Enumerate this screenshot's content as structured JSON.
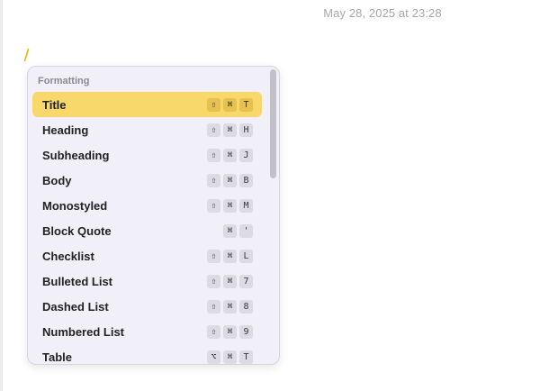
{
  "note": {
    "timestamp": "May 28, 2025 at 23:28",
    "cursor_char": "/"
  },
  "popup": {
    "section_title": "Formatting",
    "scroll_position": 0,
    "items": [
      {
        "label": "Title",
        "keys": [
          "⇧",
          "⌘",
          "T"
        ],
        "selected": true
      },
      {
        "label": "Heading",
        "keys": [
          "⇧",
          "⌘",
          "H"
        ],
        "selected": false
      },
      {
        "label": "Subheading",
        "keys": [
          "⇧",
          "⌘",
          "J"
        ],
        "selected": false
      },
      {
        "label": "Body",
        "keys": [
          "⇧",
          "⌘",
          "B"
        ],
        "selected": false
      },
      {
        "label": "Monostyled",
        "keys": [
          "⇧",
          "⌘",
          "M"
        ],
        "selected": false
      },
      {
        "label": "Block Quote",
        "keys": [
          "⌘",
          "'"
        ],
        "selected": false
      },
      {
        "label": "Checklist",
        "keys": [
          "⇧",
          "⌘",
          "L"
        ],
        "selected": false
      },
      {
        "label": "Bulleted List",
        "keys": [
          "⇧",
          "⌘",
          "7"
        ],
        "selected": false
      },
      {
        "label": "Dashed List",
        "keys": [
          "⇧",
          "⌘",
          "8"
        ],
        "selected": false
      },
      {
        "label": "Numbered List",
        "keys": [
          "⇧",
          "⌘",
          "9"
        ],
        "selected": false
      },
      {
        "label": "Table",
        "keys": [
          "⌥",
          "⌘",
          "T"
        ],
        "selected": false
      }
    ]
  },
  "colors": {
    "selection": "#f8d86a",
    "popup_background": "#f1eff8",
    "cursor": "#e8b400"
  }
}
